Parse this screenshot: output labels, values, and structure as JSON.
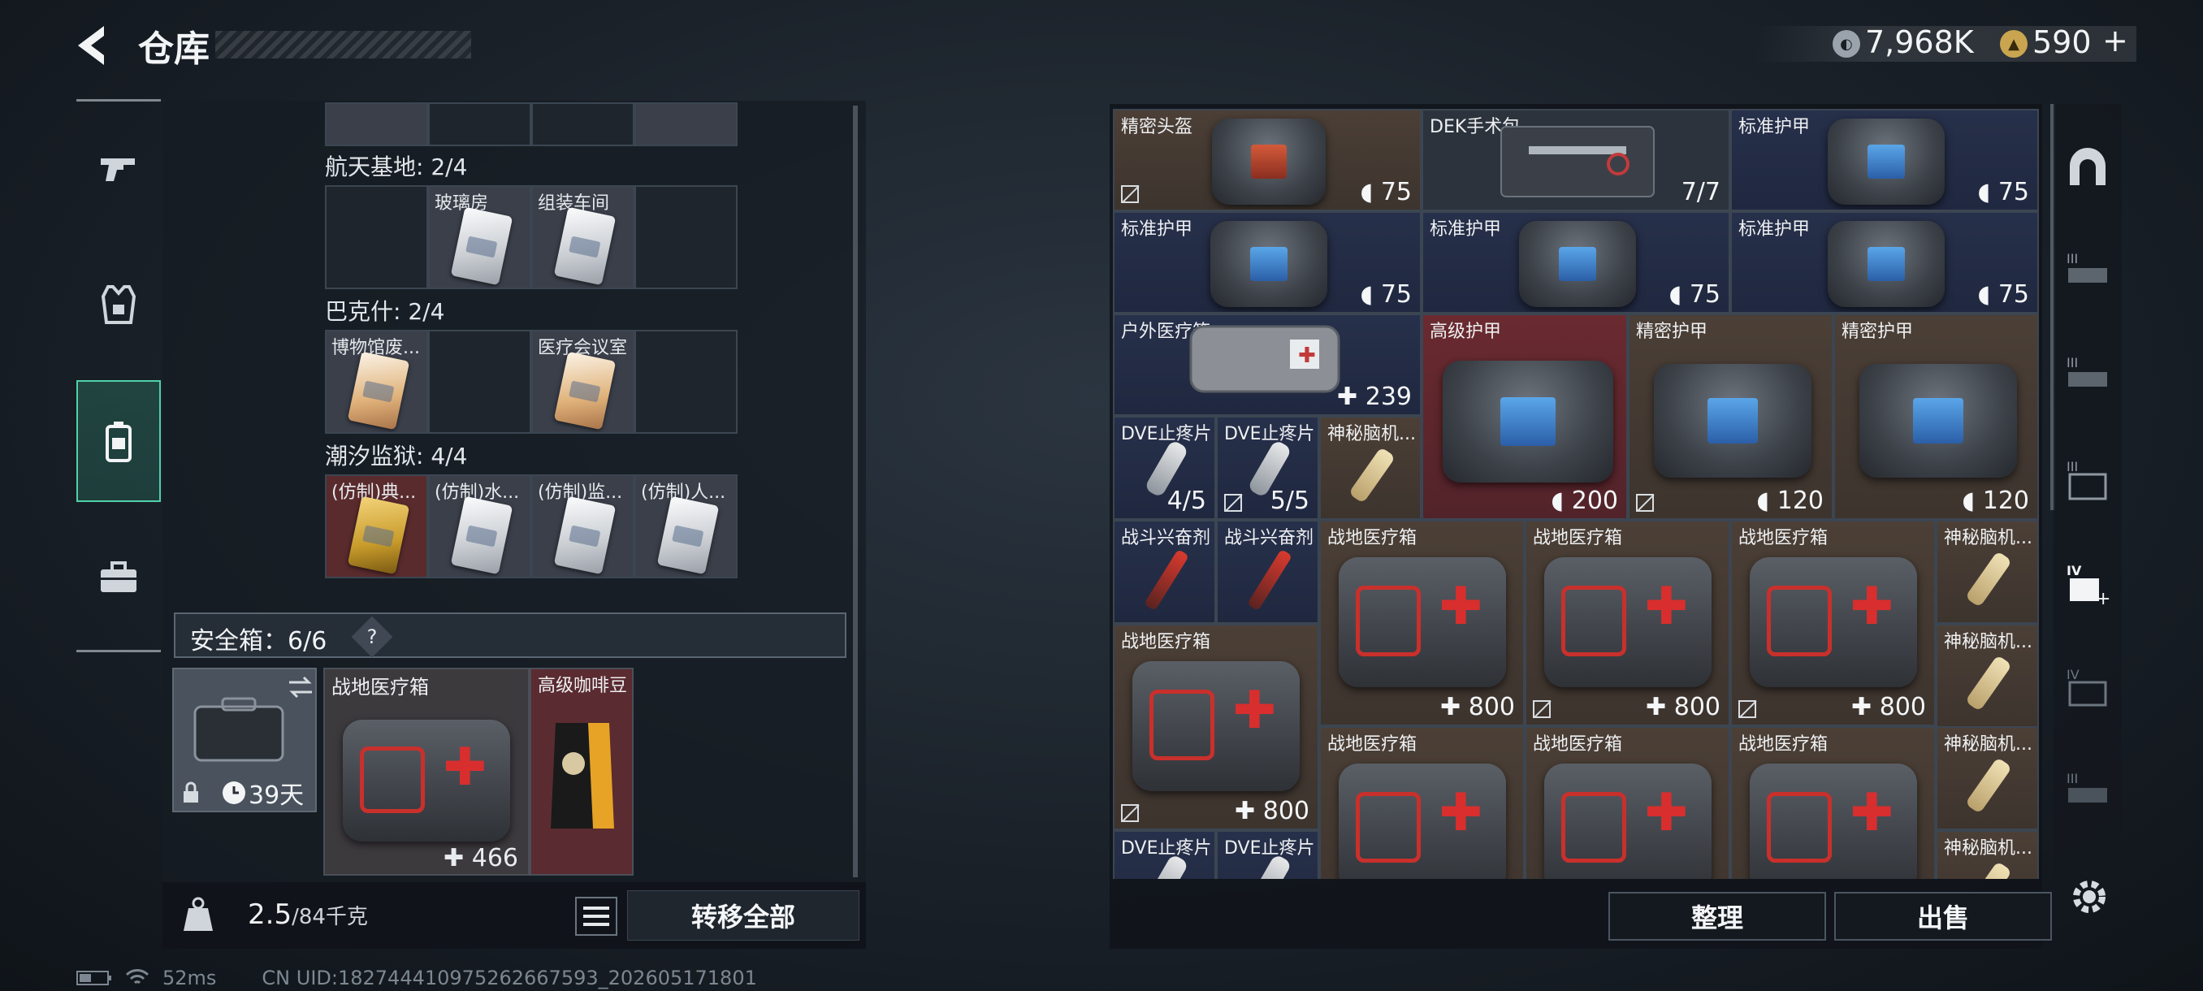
{
  "header": {
    "title": "仓库",
    "currency_silver": "7,968K",
    "currency_gold": "590",
    "add_symbol": "+"
  },
  "left": {
    "categories": [
      {
        "label": "航天基地: 2/4",
        "slots": [
          "",
          "玻璃房",
          "组装车间",
          ""
        ]
      },
      {
        "label": "巴克什: 2/4",
        "slots": [
          "博物馆废...",
          "",
          "医疗会议室",
          ""
        ]
      },
      {
        "label": "潮汐监狱: 4/4",
        "slots": [
          "(仿制)典...",
          "(仿制)水...",
          "(仿制)监...",
          "(仿制)人..."
        ]
      }
    ],
    "safe_box": {
      "label": "安全箱：6/6",
      "help": "?",
      "days": "39天"
    },
    "safe_items": [
      {
        "name": "战地医疗箱",
        "value": "466"
      },
      {
        "name": "高级咖啡豆"
      }
    ],
    "weight": {
      "current": "2.5",
      "max": "/84千克"
    },
    "transfer_all": "转移全部"
  },
  "status": {
    "ping": "52ms",
    "uid": "CN UID:1827444109752626675​93_202605171801"
  },
  "grid": {
    "cells": [
      {
        "name": "精密头盔",
        "value": "75"
      },
      {
        "name": "DEK手术包",
        "value": "7/7"
      },
      {
        "name": "标准护甲",
        "value": "75"
      },
      {
        "name": "标准护甲",
        "value": "75"
      },
      {
        "name": "标准护甲",
        "value": "75"
      },
      {
        "name": "标准护甲",
        "value": "75"
      },
      {
        "name": "户外医疗箱",
        "value": "239"
      },
      {
        "name": "高级护甲",
        "value": "200"
      },
      {
        "name": "精密护甲",
        "value": "120"
      },
      {
        "name": "精密护甲",
        "value": "120"
      },
      {
        "name": "DVE止疼片",
        "value": "4/5"
      },
      {
        "name": "DVE止疼片",
        "value": "5/5"
      },
      {
        "name": "神秘脑机..."
      },
      {
        "name": "战斗兴奋剂"
      },
      {
        "name": "战斗兴奋剂"
      },
      {
        "name": "战地医疗箱",
        "value": "800"
      },
      {
        "name": "战地医疗箱",
        "value": "800"
      },
      {
        "name": "战地医疗箱",
        "value": "800"
      },
      {
        "name": "神秘脑机..."
      },
      {
        "name": "战地医疗箱",
        "value": "800"
      },
      {
        "name": "神秘脑机..."
      },
      {
        "name": "战地医疗箱"
      },
      {
        "name": "战地医疗箱"
      },
      {
        "name": "战地医疗箱"
      },
      {
        "name": "神秘脑机..."
      },
      {
        "name": "DVE止疼片"
      },
      {
        "name": "DVE止疼片"
      },
      {
        "name": "神秘脑机..."
      }
    ]
  },
  "buttons": {
    "sort": "整理",
    "sell": "出售"
  },
  "colors": {
    "accent": "#4fd1a8",
    "brown": "#4b3f36",
    "navy": "#27304a",
    "red": "#6a2a30"
  }
}
